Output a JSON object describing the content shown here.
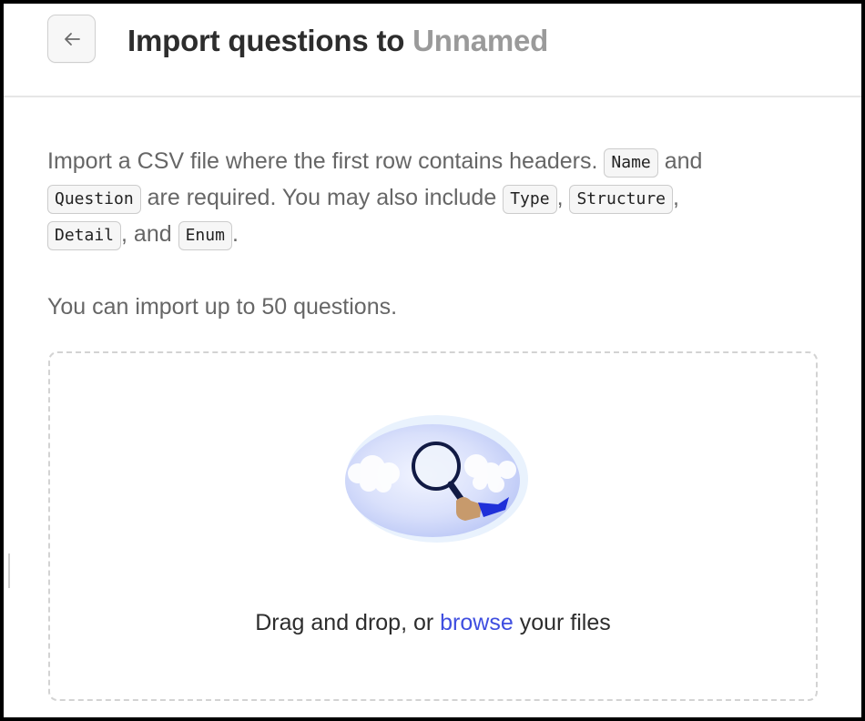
{
  "header": {
    "back_label": "←",
    "title_prefix": "Import questions to",
    "title_target": "Unnamed"
  },
  "instructions": {
    "t1": "Import a CSV file where the first row contains headers.",
    "t2": "and",
    "t3": "are required. You may also include",
    "t4": ",",
    "t5": ",",
    "t6": ", and",
    "t7": ".",
    "required_fields": [
      "Name",
      "Question"
    ],
    "optional_fields": [
      "Type",
      "Structure",
      "Detail",
      "Enum"
    ]
  },
  "limit_text": "You can import up to 50 questions.",
  "dropzone": {
    "illustration": "magnifying-glass-illustration",
    "text_before": "Drag and drop, or",
    "link_text": "browse",
    "text_after": "your files"
  },
  "colors": {
    "link": "#3f4ee0",
    "title_muted": "#9a9a9a",
    "text": "#666666"
  }
}
